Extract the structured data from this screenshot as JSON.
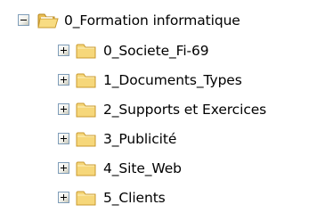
{
  "tree": {
    "root": {
      "label": "0_Formation informatique",
      "expanded": true,
      "icon": "open-folder-icon"
    },
    "children": [
      {
        "label": "0_Societe_Fi-69",
        "expanded": false,
        "icon": "folder-icon"
      },
      {
        "label": "1_Documents_Types",
        "expanded": false,
        "icon": "folder-icon"
      },
      {
        "label": "2_Supports et Exercices",
        "expanded": false,
        "icon": "folder-icon"
      },
      {
        "label": "3_Publicité",
        "expanded": false,
        "icon": "folder-icon"
      },
      {
        "label": "4_Site_Web",
        "expanded": false,
        "icon": "folder-icon"
      },
      {
        "label": "5_Clients",
        "expanded": false,
        "icon": "folder-icon"
      }
    ]
  },
  "colors": {
    "folder_fill": "#f6d77a",
    "folder_outline": "#c99a2e",
    "expander_border": "#7f9db9"
  }
}
